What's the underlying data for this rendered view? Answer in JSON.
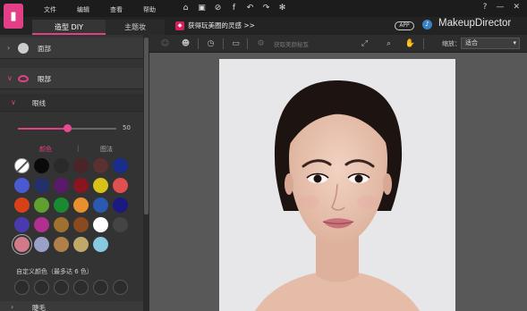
{
  "menu": [
    "文件",
    "编辑",
    "查看",
    "帮助"
  ],
  "toolbar_icons": [
    "home-icon",
    "save-icon",
    "share-link-icon",
    "facebook-icon",
    "undo-icon",
    "redo-icon",
    "settings-icon"
  ],
  "window_controls": [
    "?",
    "—",
    "✕"
  ],
  "tabs": {
    "diy": "造型 DIY",
    "makeup": "主题妆"
  },
  "promo": "获得玩美圈的灵感 >>",
  "app_badge": "APP",
  "brand": "MakeupDirector",
  "panel": {
    "face_label": "面部",
    "eye_label": "眼部",
    "eyeliner_label": "眼线",
    "slider_value": "50",
    "slider_fraction": 0.5,
    "tab_color": "颜色",
    "tab_pattern": "图法",
    "custom_label": "自定义颜色（最多达 6 色）",
    "lash_label": "睫毛"
  },
  "swatches": [
    [
      "none",
      "#0a0a0a",
      "#2a2a2a",
      "#4a2428",
      "#5a3030",
      "#1a2d8c"
    ],
    [
      "#4a5ad0",
      "#23306a",
      "#5a1a6a",
      "#8a1420",
      "#d8c21a",
      "#e05050"
    ],
    [
      "#d84018",
      "#60a030",
      "#1a8a30",
      "#e89030",
      "#2a5ab0",
      "#1a1a80"
    ],
    [
      "#4a3ab0",
      "#b03090",
      "#a07030",
      "#8a4a20",
      "#ffffff",
      "#444444"
    ],
    [
      "#d07a8a",
      "#9aa0c8",
      "#b08048",
      "#c0a868",
      "#88c8e0"
    ]
  ],
  "selected_swatch": [
    4,
    0
  ],
  "main_toolbar_hint": "获取美颜秘笈",
  "zoom_label": "缩放：",
  "zoom_value": "适合"
}
